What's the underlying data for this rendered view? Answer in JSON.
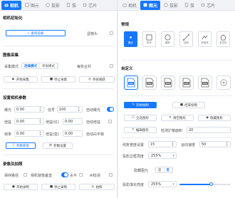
{
  "left": {
    "tabs": [
      {
        "label": "相机",
        "icon": "camera-icon",
        "state": "on"
      },
      {
        "label": "图元",
        "icon": "shapes-icon",
        "state": "normal"
      },
      {
        "label": "投影",
        "icon": "projection-icon",
        "state": "normal"
      },
      {
        "label": "泵",
        "icon": "pump-icon",
        "state": "normal"
      },
      {
        "label": "芯片",
        "icon": "chip-icon",
        "state": "normal"
      }
    ],
    "init": {
      "title": "相机初始化",
      "search_button": "查询设备",
      "debug_label": "显微头"
    },
    "capture": {
      "title": "图像采集",
      "mode_label": "采集模式",
      "modes": [
        "连续模式",
        "单张模式"
      ],
      "selected_mode": "连续模式",
      "save_label": "每张合并",
      "start_button": "开始采集",
      "stop_button": "停止采集",
      "single_button": "单张捕获"
    },
    "params": {
      "title": "设置相机参数",
      "exposure_label": "曝光",
      "exposure_value": "0.00",
      "gain_label": "增益",
      "gain_value": "0.00",
      "framerate_label": "帧率",
      "framerate_value": "0.00",
      "signal_label": "信号",
      "signal_value": "100",
      "gain_r_label": "增益(红)",
      "gain_r_value": "0.00",
      "gain_b_label": "增益(蓝)",
      "gain_b_value": "0.00",
      "auto_exposure_label": "自动曝光",
      "auto_gain_label": "自动增益",
      "auto_wb_label": "自动白平衡",
      "get_button": "参数获取",
      "set_button": "参数设置"
    },
    "snapshot": {
      "title": "录像及拍照",
      "save_path_label": "保存路径",
      "mirror_label": "相机镜像垂直",
      "flip_h_label": "水平",
      "ai_label": "AI检测",
      "record_button": "开始录制",
      "stop_record_button": "停止录制",
      "photo_button": "拍照"
    }
  },
  "right": {
    "tabs": [
      {
        "label": "相机",
        "icon": "camera-icon",
        "state": "normal"
      },
      {
        "label": "图元",
        "icon": "shapes-icon",
        "state": "on"
      },
      {
        "label": "投影",
        "icon": "projection-icon",
        "state": "normal"
      },
      {
        "label": "泵",
        "icon": "pump-icon",
        "state": "normal"
      },
      {
        "label": "芯片",
        "icon": "chip-icon",
        "state": "normal"
      }
    ],
    "general": {
      "title": "常规",
      "shapes": [
        {
          "label": "圆点",
          "icon": "dot-icon",
          "selected": true
        },
        {
          "label": "矩形",
          "icon": "square-icon",
          "selected": false
        },
        {
          "label": "圆形",
          "icon": "circle-icon",
          "selected": false
        },
        {
          "label": "线段",
          "icon": "line-icon",
          "selected": false
        },
        {
          "label": "多段线",
          "icon": "polyline-icon",
          "selected": false
        },
        {
          "label": "多边形",
          "icon": "polygon-icon",
          "selected": false
        }
      ]
    },
    "custom": {
      "title": "自定义",
      "items": [
        {
          "label": "BMP",
          "icon": "bmp-file-icon",
          "selected": true
        },
        {
          "label": "BMP",
          "icon": "bmp-file-icon",
          "selected": false
        },
        {
          "label": "BMP",
          "icon": "bmp-file-icon",
          "selected": false
        },
        {
          "label": "BMP",
          "icon": "bmp-file-icon",
          "selected": false
        },
        {
          "label": "BMP",
          "icon": "bmp-file-icon",
          "selected": false
        },
        {
          "label": "添加",
          "icon": "plus-icon",
          "selected": false
        }
      ]
    },
    "actions": {
      "start_draw": "开始绘制",
      "finish_draw": "结束绘制",
      "select_all": "全选图形",
      "clear_all": "清空图形",
      "hide_all": "隐藏图形",
      "edit_graphic": "编辑图形",
      "check_scale_label": "检测扩散面积",
      "check_scale_value": "20"
    },
    "params": {
      "line_width_label": "线条宽度设置",
      "line_width_value": "15",
      "speed_label": "运动速度",
      "speed_value": "50",
      "projection_brightness_label": "投影边框亮度",
      "projection_brightness_value": "255%",
      "hide_label": "隐藏图元",
      "hide_options": [
        "是",
        "否"
      ],
      "hide_selected": "否",
      "fill_brightness_label": "投影填充亮度",
      "fill_brightness_value": "255%",
      "fill_level": 0.62
    }
  },
  "colors": {
    "accent": "#1677ff",
    "background": "#eef1f6",
    "panel": "#ffffff"
  }
}
